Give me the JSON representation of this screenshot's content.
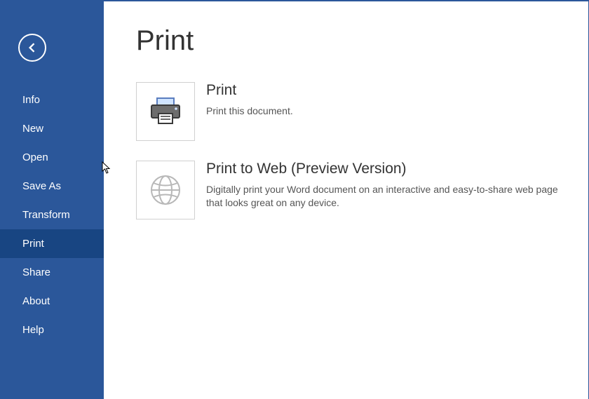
{
  "sidebar": {
    "items": [
      {
        "label": "Info",
        "selected": false
      },
      {
        "label": "New",
        "selected": false
      },
      {
        "label": "Open",
        "selected": false
      },
      {
        "label": "Save As",
        "selected": false
      },
      {
        "label": "Transform",
        "selected": false
      },
      {
        "label": "Print",
        "selected": true
      },
      {
        "label": "Share",
        "selected": false
      },
      {
        "label": "About",
        "selected": false
      },
      {
        "label": "Help",
        "selected": false
      }
    ]
  },
  "page": {
    "title": "Print",
    "options": [
      {
        "icon": "printer-icon",
        "title": "Print",
        "desc": "Print this document."
      },
      {
        "icon": "globe-icon",
        "title": "Print to Web (Preview Version)",
        "desc": "Digitally print your Word document on an interactive and easy-to-share web page that looks great on any device."
      }
    ]
  }
}
